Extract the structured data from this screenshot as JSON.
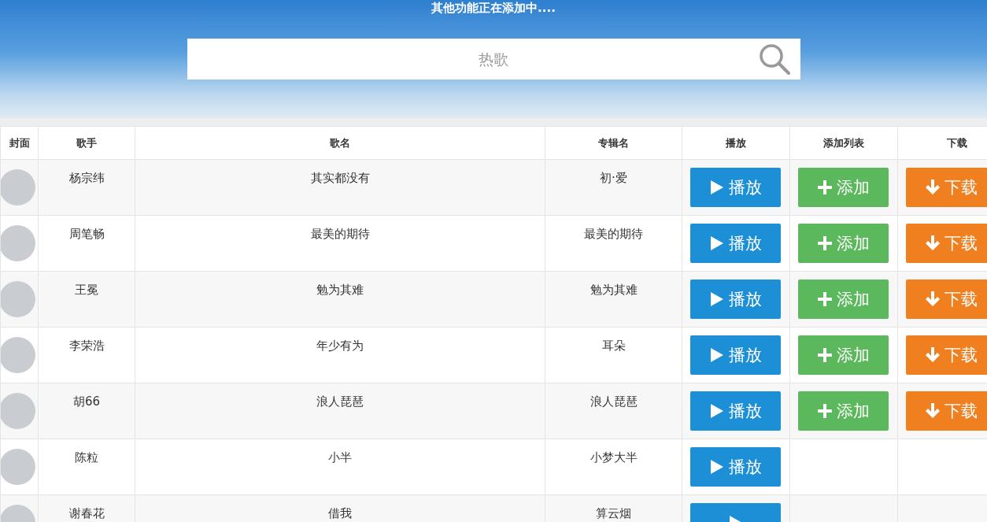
{
  "header": {
    "notice": "其他功能正在添加中....",
    "search": {
      "placeholder": "热歌"
    }
  },
  "table": {
    "columns": [
      "封面",
      "歌手",
      "歌名",
      "专辑名",
      "播放",
      "添加列表",
      "下载"
    ],
    "rows": [
      {
        "singer": "杨宗纬",
        "song": "其实都没有",
        "album": "初·爱",
        "actions": [
          {
            "kind": "play",
            "label": "播放"
          },
          {
            "kind": "add",
            "label": "添加"
          },
          {
            "kind": "download",
            "label": "下载"
          }
        ]
      },
      {
        "singer": "周笔畅",
        "song": "最美的期待",
        "album": "最美的期待",
        "actions": [
          {
            "kind": "play",
            "label": "播放"
          },
          {
            "kind": "add",
            "label": "添加"
          },
          {
            "kind": "download",
            "label": "下载"
          }
        ]
      },
      {
        "singer": "王冕",
        "song": "勉为其难",
        "album": "勉为其难",
        "actions": [
          {
            "kind": "play",
            "label": "播放"
          },
          {
            "kind": "add",
            "label": "添加"
          },
          {
            "kind": "download",
            "label": "下载"
          }
        ]
      },
      {
        "singer": "李荣浩",
        "song": "年少有为",
        "album": "耳朵",
        "actions": [
          {
            "kind": "play",
            "label": "播放"
          },
          {
            "kind": "add",
            "label": "添加"
          },
          {
            "kind": "download",
            "label": "下载"
          }
        ]
      },
      {
        "singer": "胡66",
        "song": "浪人琵琶",
        "album": "浪人琵琶",
        "actions": [
          {
            "kind": "play",
            "label": "播放"
          },
          {
            "kind": "add",
            "label": "添加"
          },
          {
            "kind": "download",
            "label": "下载"
          }
        ]
      },
      {
        "singer": "陈粒",
        "song": "小半",
        "album": "小梦大半",
        "actions": [
          {
            "kind": "play",
            "label": "播放"
          }
        ]
      },
      {
        "singer": "谢春花",
        "song": "借我",
        "album": "算云烟",
        "actions": [
          {
            "kind": "play"
          }
        ]
      }
    ]
  }
}
